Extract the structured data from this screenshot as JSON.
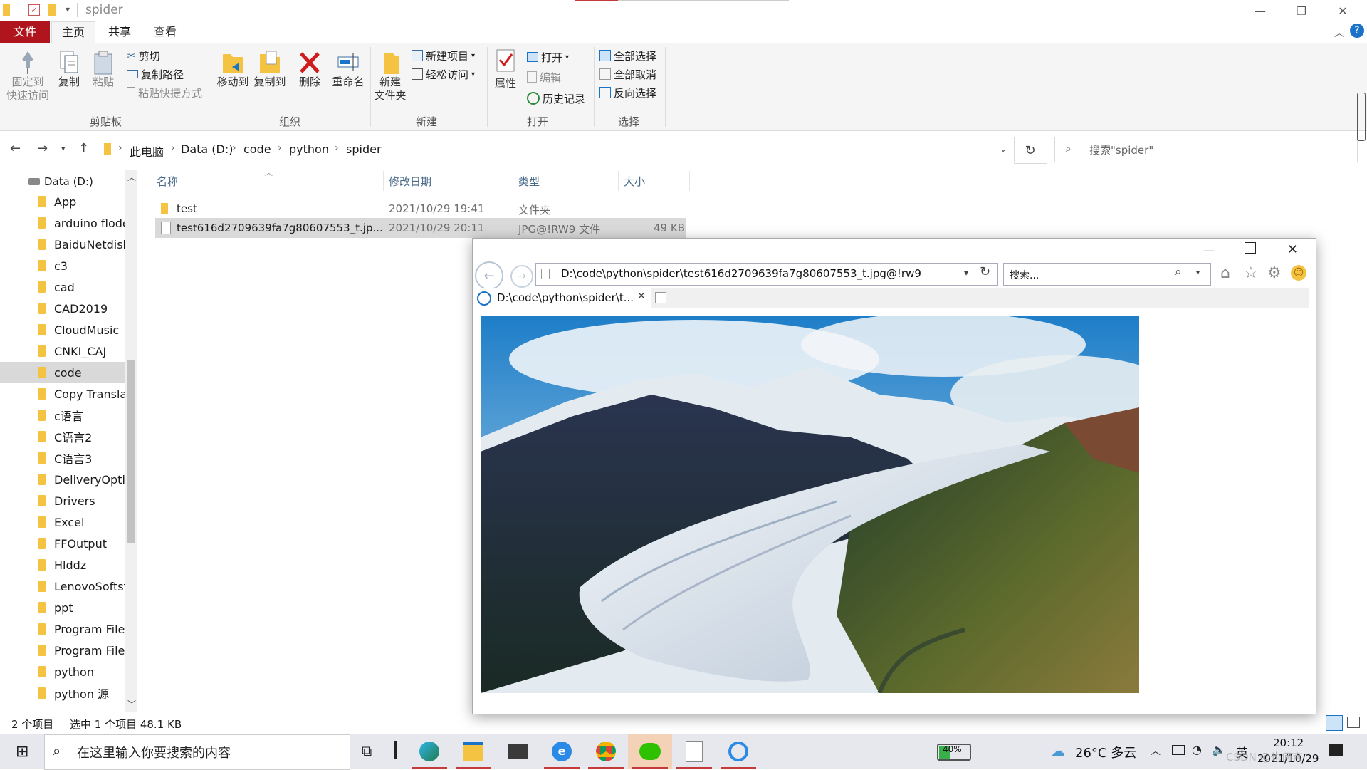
{
  "window": {
    "title": "spider",
    "minimize": "—",
    "maximize": "❐",
    "close": "✕"
  },
  "ribbon_tabs": {
    "file": "文件",
    "home": "主页",
    "share": "共享",
    "view": "查看"
  },
  "ribbon": {
    "pin": [
      "固定到",
      "快速访问"
    ],
    "copy": "复制",
    "paste": "粘贴",
    "cut": "剪切",
    "copy_path": "复制路径",
    "paste_shortcut": "粘贴快捷方式",
    "move_to": "移动到",
    "copy_to": "复制到",
    "delete": "删除",
    "rename": "重命名",
    "new_folder": [
      "新建",
      "文件夹"
    ],
    "new_item": "新建项目",
    "easy_access": "轻松访问",
    "properties": "属性",
    "open": "打开",
    "edit": "编辑",
    "history": "历史记录",
    "select_all": "全部选择",
    "select_none": "全部取消",
    "invert_selection": "反向选择",
    "groups": {
      "clipboard": "剪贴板",
      "organize": "组织",
      "new": "新建",
      "open": "打开",
      "select": "选择"
    }
  },
  "address": {
    "crumbs": [
      "此电脑",
      "Data (D:)",
      "code",
      "python",
      "spider"
    ],
    "search_placeholder": "搜索\"spider\""
  },
  "nav": {
    "drive": "Data (D:)",
    "items": [
      "App",
      "arduino flode",
      "BaiduNetdiskl",
      "c3",
      "cad",
      "CAD2019",
      "CloudMusic",
      "CNKI_CAJ",
      "code",
      "Copy Translat",
      "c语言",
      "C语言2",
      "C语言3",
      "DeliveryOptin",
      "Drivers",
      "Excel",
      "FFOutput",
      "Hlddz",
      "LenovoSoftst",
      "ppt",
      "Program Files",
      "Program Files",
      "python",
      "python 源"
    ],
    "selected_index": 8
  },
  "columns": {
    "name": "名称",
    "modified": "修改日期",
    "type": "类型",
    "size": "大小"
  },
  "files": [
    {
      "name": "test",
      "modified": "2021/10/29 19:41",
      "type": "文件夹",
      "size": ""
    },
    {
      "name": "test616d2709639fa7g80607553_t.jp...",
      "modified": "2021/10/29 20:11",
      "type": "JPG@!RW9 文件",
      "size": "49 KB"
    }
  ],
  "status": {
    "count": "2 个项目",
    "selected": "选中 1 个项目  48.1 KB"
  },
  "ie": {
    "address": "D:\\code\\python\\spider\\test616d2709639fa7g80607553_t.jpg@!rw9",
    "search_placeholder": "搜索...",
    "tab_title": "D:\\code\\python\\spider\\t...",
    "tab_close": "✕"
  },
  "taskbar": {
    "search_placeholder": "在这里输入你要搜索的内容",
    "battery": "40%",
    "weather": "26°C  多云",
    "ime": "英",
    "time": "20:12",
    "date": "2021/10/29",
    "watermark": "CSDN @也何言"
  },
  "colors": {
    "file_tab": "#b0141c",
    "accent": "#1a73c8",
    "folder": "#f5c342",
    "selection": "#d9d9d9"
  }
}
